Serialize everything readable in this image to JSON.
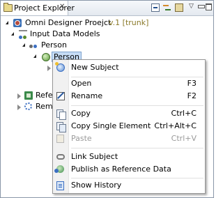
{
  "view": {
    "title": "Project Explorer",
    "close_glyph": "✕",
    "menu_glyph": "▽",
    "toolbar_icons": [
      "collapse-all-icon",
      "link-with-editor-icon",
      "sync-icon",
      "view-menu-icon",
      "minimize-icon",
      "maximize-icon"
    ]
  },
  "tree": {
    "project": {
      "name": "Omni Designer Proejct",
      "branch": "v.1 [trunk]"
    },
    "input_models": "Input Data Models",
    "subject_area": "Person",
    "selected_entity": "Person",
    "ref_node": "Refere",
    "rem_node": "Reme"
  },
  "context_menu": {
    "items": [
      {
        "label": "New Subject",
        "shortcut": "",
        "icon": "new-subject-icon",
        "enabled": true
      },
      {
        "label": "Open",
        "shortcut": "F3",
        "icon": "",
        "enabled": true
      },
      {
        "label": "Rename",
        "shortcut": "F2",
        "icon": "rename-icon",
        "enabled": true
      },
      {
        "label": "Copy",
        "shortcut": "Ctrl+C",
        "icon": "copy-icon",
        "enabled": true
      },
      {
        "label": "Copy Single Element",
        "shortcut": "Ctrl+Alt+C",
        "icon": "copy-single-element-icon",
        "enabled": true
      },
      {
        "label": "Paste",
        "shortcut": "Ctrl+V",
        "icon": "paste-icon",
        "enabled": false
      },
      {
        "label": "Link Subject",
        "shortcut": "",
        "icon": "link-icon",
        "enabled": true
      },
      {
        "label": "Publish as Reference Data",
        "shortcut": "",
        "icon": "publish-icon",
        "enabled": true
      },
      {
        "label": "Show History",
        "shortcut": "",
        "icon": "history-icon",
        "enabled": true
      }
    ]
  },
  "colors": {
    "selection_bg": "#c6dcf5",
    "branch_text": "#8a7a2a",
    "disabled_text": "#9a9a9a"
  }
}
